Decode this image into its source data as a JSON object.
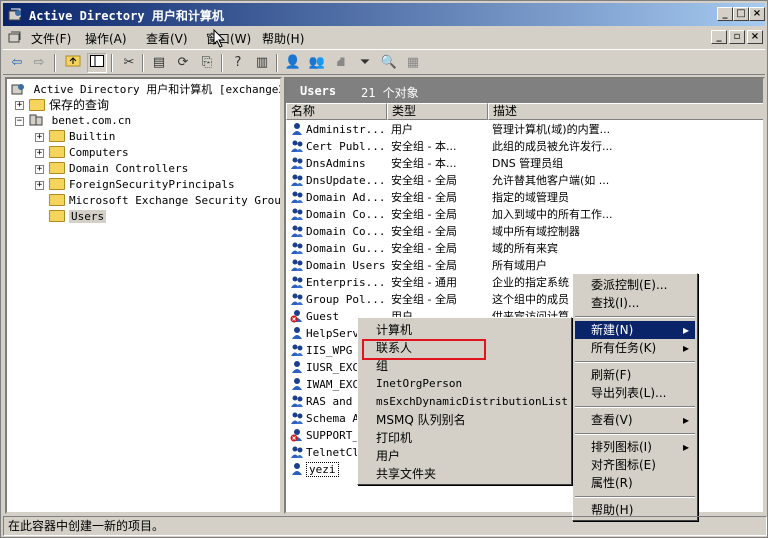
{
  "window": {
    "title": "Active Directory 用户和计算机"
  },
  "menubar": {
    "items": [
      "文件(F)",
      "操作(A)",
      "查看(V)",
      "窗口(W)",
      "帮助(H)"
    ]
  },
  "tree": {
    "root": "Active Directory 用户和计算机 [exchange200",
    "saved": "保存的查询",
    "domain": "benet.com.cn",
    "children": [
      "Builtin",
      "Computers",
      "Domain Controllers",
      "ForeignSecurityPrincipals",
      "Microsoft Exchange Security Groups",
      "Users"
    ]
  },
  "list": {
    "header_title": "Users",
    "header_count": "21 个对象",
    "columns": [
      "名称",
      "类型",
      "描述"
    ],
    "rows": [
      {
        "name": "Administr...",
        "type": "用户",
        "desc": "管理计算机(域)的内置..."
      },
      {
        "name": "Cert Publ...",
        "type": "安全组 - 本...",
        "desc": "此组的成员被允许发行..."
      },
      {
        "name": "DnsAdmins",
        "type": "安全组 - 本...",
        "desc": "DNS 管理员组"
      },
      {
        "name": "DnsUpdate...",
        "type": "安全组 - 全局",
        "desc": "允许替其他客户端(如 ..."
      },
      {
        "name": "Domain Ad...",
        "type": "安全组 - 全局",
        "desc": "指定的域管理员"
      },
      {
        "name": "Domain Co...",
        "type": "安全组 - 全局",
        "desc": "加入到域中的所有工作..."
      },
      {
        "name": "Domain Co...",
        "type": "安全组 - 全局",
        "desc": "域中所有域控制器"
      },
      {
        "name": "Domain Gu...",
        "type": "安全组 - 全局",
        "desc": "域的所有来宾"
      },
      {
        "name": "Domain Users",
        "type": "安全组 - 全局",
        "desc": "所有域用户"
      },
      {
        "name": "Enterpris...",
        "type": "安全组 - 通用",
        "desc": "企业的指定系统"
      },
      {
        "name": "Group Pol...",
        "type": "安全组 - 全局",
        "desc": "这个组中的成员"
      },
      {
        "name": "Guest",
        "type": "用户",
        "desc": "供来宾访问计算"
      },
      {
        "name": "HelpServ",
        "type": "",
        "desc": ""
      },
      {
        "name": "IIS_WPG",
        "type": "",
        "desc": ""
      },
      {
        "name": "IUSR_EXC",
        "type": "",
        "desc": ""
      },
      {
        "name": "IWAM_EXC",
        "type": "",
        "desc": ""
      },
      {
        "name": "RAS and",
        "type": "",
        "desc": ""
      },
      {
        "name": "Schema A",
        "type": "",
        "desc": ""
      },
      {
        "name": "SUPPORT_",
        "type": "",
        "desc": ""
      },
      {
        "name": "TelnetCl",
        "type": "",
        "desc": ""
      },
      {
        "name": "yezi",
        "type": "",
        "desc": ""
      }
    ]
  },
  "context_menu": {
    "items": [
      "委派控制(E)...",
      "查找(I)...",
      "新建(N)",
      "所有任务(K)",
      "刷新(F)",
      "导出列表(L)...",
      "查看(V)",
      "排列图标(I)",
      "对齐图标(E)",
      "属性(R)",
      "帮助(H)"
    ]
  },
  "submenu": {
    "items": [
      "计算机",
      "联系人",
      "组",
      "InetOrgPerson",
      "msExchDynamicDistributionList",
      "MSMQ 队列别名",
      "打印机",
      "用户",
      "共享文件夹"
    ]
  },
  "status": {
    "text": "在此容器中创建一新的项目。"
  }
}
